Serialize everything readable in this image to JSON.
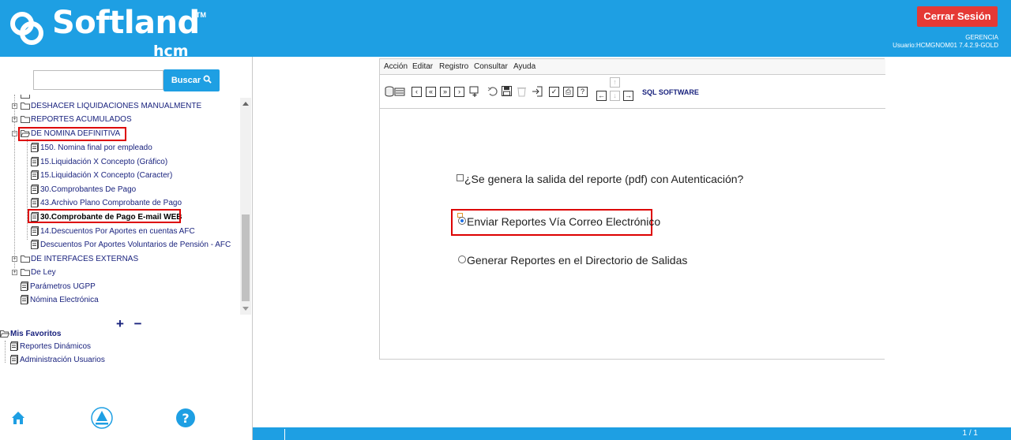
{
  "header": {
    "logo_text": "Softland",
    "logo_tm": "TM",
    "logo_sub": "hcm",
    "logout_label": "Cerrar Sesión",
    "company": "GERENCIA",
    "user_line": "Usuario:HCMGNOM01 7.4.2.9-GOLD"
  },
  "sidebar": {
    "search_button": "Buscar",
    "tree": {
      "folder_1": "DESHACER LIQUIDACIONES MANUALMENTE",
      "folder_2": "REPORTES ACUMULADOS",
      "folder_3": "DE NOMINA DEFINITIVA",
      "report_1": "150. Nomina final por empleado",
      "report_2": "15.Liquidación X Concepto (Gráfico)",
      "report_3": "15.Liquidación X Concepto (Caracter)",
      "report_4": "30.Comprobantes De Pago",
      "report_5": "43.Archivo Plano Comprobante de Pago",
      "report_6": "30.Comprobante de Pago E-mail WEB",
      "report_7": "14.Descuentos Por Aportes en cuentas AFC",
      "report_8": "Descuentos Por Aportes Voluntarios de Pensión - AFC",
      "folder_4": "DE INTERFACES EXTERNAS",
      "folder_5": "De Ley",
      "report_9": "Parámetros UGPP",
      "report_10": "Nómina Electrónica"
    },
    "plus_minus": "+ −",
    "favorites": {
      "title": "Mis Favoritos",
      "item_1": "Reportes Dinámicos",
      "item_2": "Administración Usuarios"
    }
  },
  "menu": {
    "accion": "Acción",
    "editar": "Editar",
    "registro": "Registro",
    "consultar": "Consultar",
    "ayuda": "Ayuda"
  },
  "toolbar": {
    "sql_label": "SQL SOFTWARE"
  },
  "options": {
    "auth": "¿Se genera la salida del reporte (pdf) con Autenticación?",
    "email": "Enviar Reportes Vía Correo Electrónico",
    "directory": "Generar Reportes en el Directorio de Salidas",
    "selected": "email"
  },
  "footer": {
    "page": "1 / 1"
  },
  "colors": {
    "brand_blue": "#1e9fe3",
    "logout_red": "#e53935",
    "highlight_red": "#dd0000",
    "tree_text": "#1a237e"
  }
}
